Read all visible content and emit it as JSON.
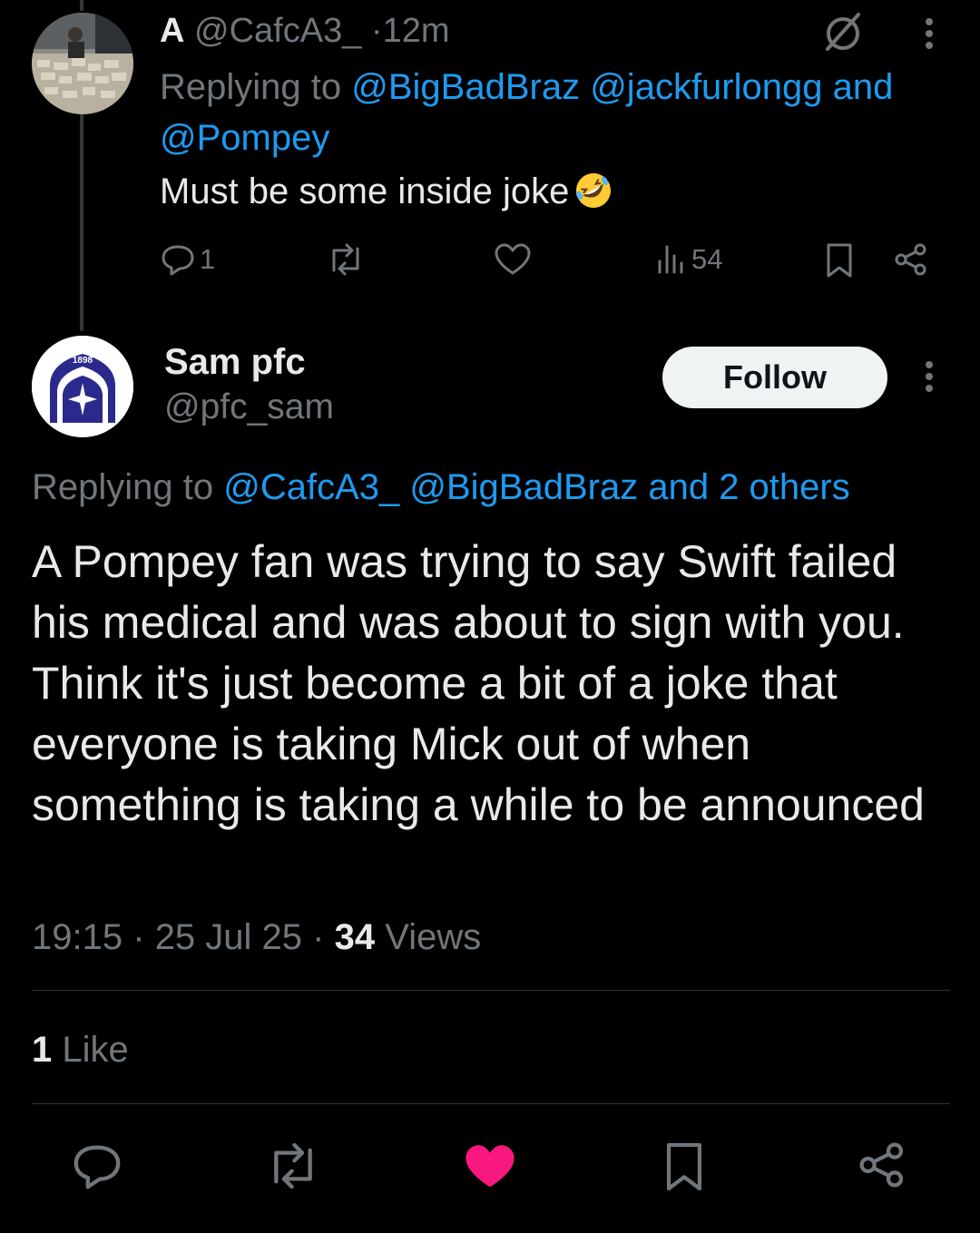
{
  "parent_tweet": {
    "display_name": "A",
    "handle": "@CafcA3_",
    "time": "12m",
    "replying_prefix": "Replying to",
    "replying_to": "@BigBadBraz @jackfurlongg and @Pompey",
    "text": "Must be some inside joke",
    "emoji": "rolling-on-floor-laughing-emoji",
    "actions": {
      "replies": "1",
      "views": "54"
    }
  },
  "main_tweet": {
    "display_name": "Sam pfc",
    "handle": "@pfc_sam",
    "follow_label": "Follow",
    "replying_prefix": "Replying to",
    "replying_to": "@CafcA3_ @BigBadBraz and 2 others",
    "text": "A Pompey fan was trying to say Swift failed his medical and was about to sign with you. Think it's just become a bit of a joke that everyone is taking Mick out of when something is taking a while to be announced",
    "time": "19:15",
    "date": "25 Jul 25",
    "views_count": "34",
    "views_label": "Views",
    "likes_count": "1",
    "likes_label": "Like",
    "avatar_badge_text": "1898"
  },
  "colors": {
    "background": "#000000",
    "text": "#e7e9ea",
    "muted": "#71767b",
    "link": "#1d9bf0",
    "like_active": "#f91880",
    "divider": "#2f3336"
  }
}
